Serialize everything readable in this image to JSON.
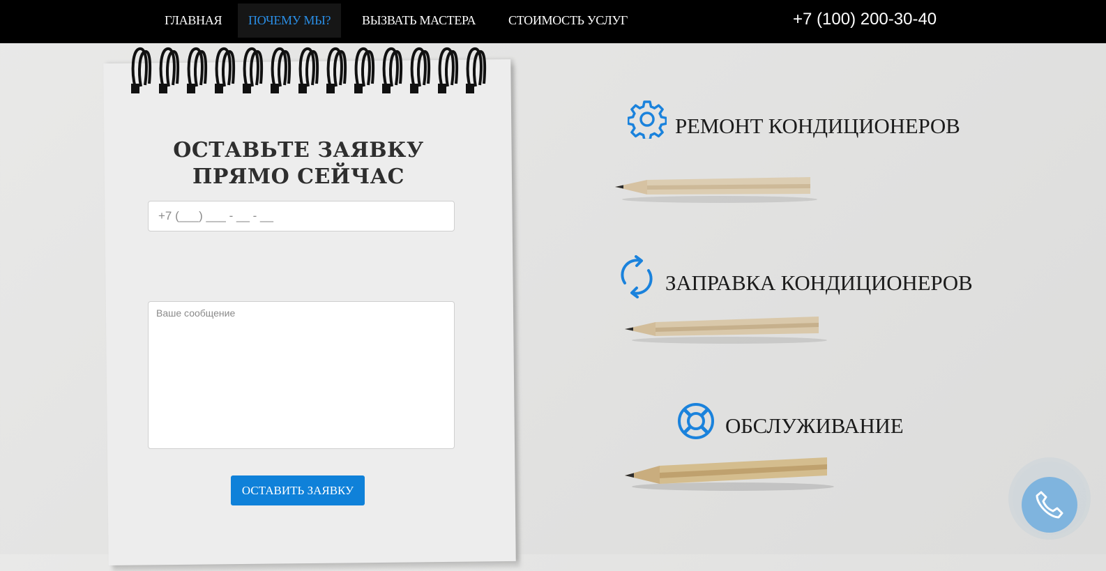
{
  "nav": {
    "items": [
      {
        "label": "Главная"
      },
      {
        "label": "Почему мы?",
        "active": true
      },
      {
        "label": "Вызвать мастера"
      },
      {
        "label": "Стоимость услуг"
      }
    ],
    "phone": "+7 (100) 200-30-40"
  },
  "form": {
    "title_line1": "Оставьте заявку",
    "title_line2": "прямо сейчас",
    "phone_placeholder": "+7 (___) ___ - __ - __",
    "message_placeholder": "Ваше сообщение",
    "submit_label": "Оставить заявку"
  },
  "services": [
    {
      "label": "Ремонт кондиционеров",
      "icon": "gear-icon"
    },
    {
      "label": "Заправка кондиционеров",
      "icon": "refresh-icon"
    },
    {
      "label": "Обслуживание",
      "icon": "lifebuoy-icon"
    }
  ],
  "call_button": {
    "icon": "phone-icon"
  },
  "colors": {
    "nav_bg": "#000000",
    "accent": "#0f81d9",
    "active_nav": "#2a8ee6",
    "icon_blue": "#1a82dc",
    "call_button": "#7fb4de"
  }
}
